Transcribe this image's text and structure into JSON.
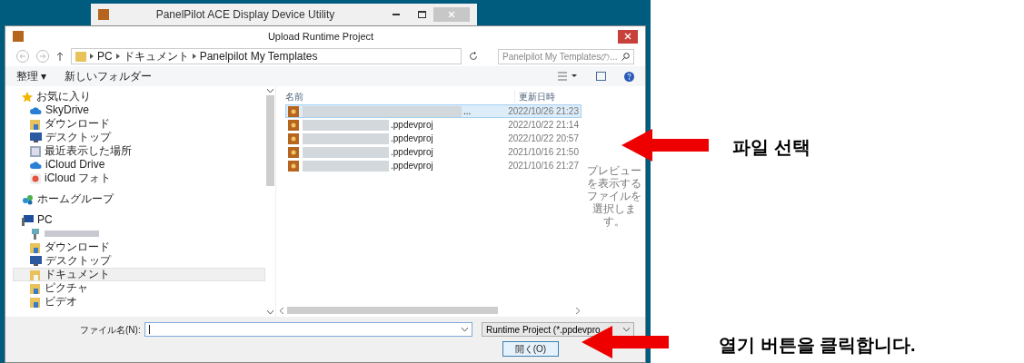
{
  "parent_window": {
    "title": "PanelPilot ACE Display Device Utility"
  },
  "dialog": {
    "title": "Upload Runtime Project",
    "address": {
      "breadcrumbs": [
        "PC",
        "ドキュメント",
        "Panelpilot My Templates"
      ],
      "search_placeholder": "Panelpilot My Templatesの..."
    },
    "toolbar": {
      "organize": "整理 ▾",
      "new_folder": "新しいフォルダー"
    },
    "sidebar": {
      "groups": [
        {
          "label": "お気に入り",
          "kind": "favorites",
          "children": [
            {
              "label": "SkyDrive",
              "kind": "cloud",
              "selected": false
            },
            {
              "label": "ダウンロード",
              "kind": "download",
              "selected": false
            },
            {
              "label": "デスクトップ",
              "kind": "desktop",
              "selected": false
            },
            {
              "label": "最近表示した場所",
              "kind": "recent",
              "selected": false
            },
            {
              "label": "iCloud Drive",
              "kind": "cloud",
              "selected": false
            },
            {
              "label": "iCloud フォト",
              "kind": "photos",
              "selected": false
            }
          ]
        },
        {
          "label": "ホームグループ",
          "kind": "homegroup"
        },
        {
          "label": "PC",
          "kind": "computer",
          "children": [
            {
              "kind": "blurred",
              "selected": false
            },
            {
              "label": "ダウンロード",
              "kind": "download",
              "selected": false
            },
            {
              "label": "デスクトップ",
              "kind": "desktop",
              "selected": false
            },
            {
              "label": "ドキュメント",
              "kind": "documents",
              "selected": true
            },
            {
              "label": "ピクチャ",
              "kind": "pictures",
              "selected": false
            },
            {
              "label": "ビデオ",
              "kind": "videos",
              "selected": false
            }
          ]
        }
      ]
    },
    "files": {
      "columns": [
        "名前",
        "更新日時"
      ],
      "rows": [
        {
          "name": "...",
          "date": "2022/10/26 21:23",
          "selected": true
        },
        {
          "name": ".ppdevproj",
          "date": "2022/10/22 21:14",
          "selected": false
        },
        {
          "name": ".ppdevproj",
          "date": "2022/10/22 20:57",
          "selected": false
        },
        {
          "name": ".ppdevproj",
          "date": "2021/10/16 21:50",
          "selected": false
        },
        {
          "name": ".ppdevproj",
          "date": "2021/10/16 21:27",
          "selected": false
        }
      ]
    },
    "preview_text": "プレビューを表示するファイルを選択します。",
    "filename_label": "ファイル名(N):",
    "filter": "Runtime Project (*.ppdevpro",
    "open_button": "開く(O)"
  },
  "annotations": [
    {
      "text": "파일 선택"
    },
    {
      "text": "열기 버튼을 클릭합니다."
    }
  ]
}
